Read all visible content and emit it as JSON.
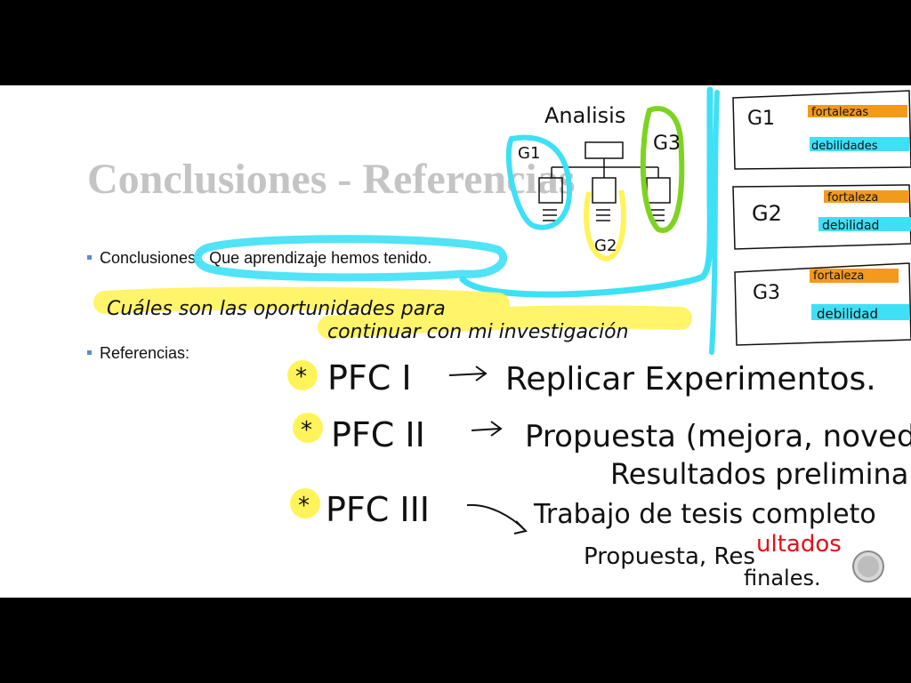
{
  "slide": {
    "title": "Conclusiones - Referencias",
    "bullets": [
      {
        "label": "Conclusiones:",
        "value": "Que aprendizaje hemos tenido."
      },
      {
        "label": "Referencias:",
        "value": ""
      }
    ]
  },
  "annotations": {
    "diagram_title": "Analisis",
    "g1": "G1",
    "g2": "G2",
    "g3": "G3",
    "box_g1": {
      "label": "G1",
      "strength": "fortalezas",
      "weakness": "debilidades"
    },
    "box_g2": {
      "label": "G2",
      "strength": "fortaleza",
      "weakness": "debilidad"
    },
    "box_g3": {
      "label": "G3",
      "strength": "fortaleza",
      "weakness": "debilidad"
    },
    "opportunity_line1": "Cuáles son las oportunidades para",
    "opportunity_line2": "continuar con mi investigación",
    "pfc1": "PFC I",
    "pfc1_text": "Replicar Experimentos.",
    "pfc2": "PFC II",
    "pfc2_text": "Propuesta (mejora, novedad)",
    "pfc2_text2": "Resultados preliminares",
    "pfc3": "PFC III",
    "pfc3_text": "Trabajo de tesis completo",
    "pfc3_text2_a": "Propuesta, Res",
    "pfc3_text2_b": "ultados",
    "pfc3_text3": "finales.",
    "star": "*"
  },
  "colors": {
    "title": "#c4c4c4",
    "bullet_marker": "#5b8cc8",
    "ink_cyan": "#3ee0f5",
    "ink_yellow": "#fff35a",
    "ink_green": "#7ed321",
    "ink_orange": "#f39a1e",
    "ink_red": "#e0101a",
    "ink_black": "#000000"
  }
}
